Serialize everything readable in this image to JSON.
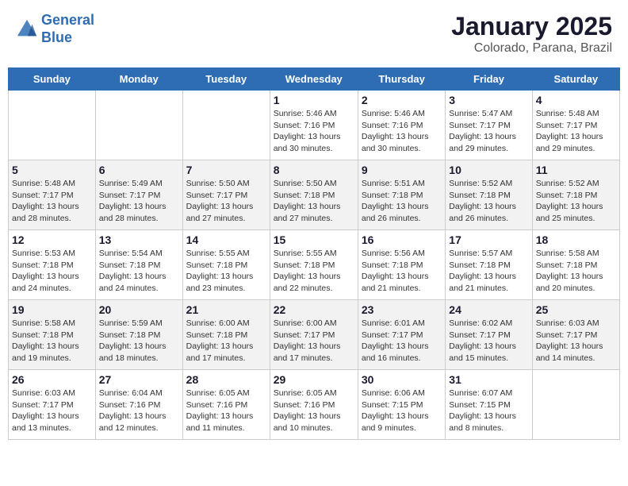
{
  "header": {
    "logo_line1": "General",
    "logo_line2": "Blue",
    "month": "January 2025",
    "location": "Colorado, Parana, Brazil"
  },
  "weekdays": [
    "Sunday",
    "Monday",
    "Tuesday",
    "Wednesday",
    "Thursday",
    "Friday",
    "Saturday"
  ],
  "weeks": [
    [
      {
        "day": "",
        "sunrise": "",
        "sunset": "",
        "daylight": ""
      },
      {
        "day": "",
        "sunrise": "",
        "sunset": "",
        "daylight": ""
      },
      {
        "day": "",
        "sunrise": "",
        "sunset": "",
        "daylight": ""
      },
      {
        "day": "1",
        "sunrise": "Sunrise: 5:46 AM",
        "sunset": "Sunset: 7:16 PM",
        "daylight": "Daylight: 13 hours and 30 minutes."
      },
      {
        "day": "2",
        "sunrise": "Sunrise: 5:46 AM",
        "sunset": "Sunset: 7:16 PM",
        "daylight": "Daylight: 13 hours and 30 minutes."
      },
      {
        "day": "3",
        "sunrise": "Sunrise: 5:47 AM",
        "sunset": "Sunset: 7:17 PM",
        "daylight": "Daylight: 13 hours and 29 minutes."
      },
      {
        "day": "4",
        "sunrise": "Sunrise: 5:48 AM",
        "sunset": "Sunset: 7:17 PM",
        "daylight": "Daylight: 13 hours and 29 minutes."
      }
    ],
    [
      {
        "day": "5",
        "sunrise": "Sunrise: 5:48 AM",
        "sunset": "Sunset: 7:17 PM",
        "daylight": "Daylight: 13 hours and 28 minutes."
      },
      {
        "day": "6",
        "sunrise": "Sunrise: 5:49 AM",
        "sunset": "Sunset: 7:17 PM",
        "daylight": "Daylight: 13 hours and 28 minutes."
      },
      {
        "day": "7",
        "sunrise": "Sunrise: 5:50 AM",
        "sunset": "Sunset: 7:17 PM",
        "daylight": "Daylight: 13 hours and 27 minutes."
      },
      {
        "day": "8",
        "sunrise": "Sunrise: 5:50 AM",
        "sunset": "Sunset: 7:18 PM",
        "daylight": "Daylight: 13 hours and 27 minutes."
      },
      {
        "day": "9",
        "sunrise": "Sunrise: 5:51 AM",
        "sunset": "Sunset: 7:18 PM",
        "daylight": "Daylight: 13 hours and 26 minutes."
      },
      {
        "day": "10",
        "sunrise": "Sunrise: 5:52 AM",
        "sunset": "Sunset: 7:18 PM",
        "daylight": "Daylight: 13 hours and 26 minutes."
      },
      {
        "day": "11",
        "sunrise": "Sunrise: 5:52 AM",
        "sunset": "Sunset: 7:18 PM",
        "daylight": "Daylight: 13 hours and 25 minutes."
      }
    ],
    [
      {
        "day": "12",
        "sunrise": "Sunrise: 5:53 AM",
        "sunset": "Sunset: 7:18 PM",
        "daylight": "Daylight: 13 hours and 24 minutes."
      },
      {
        "day": "13",
        "sunrise": "Sunrise: 5:54 AM",
        "sunset": "Sunset: 7:18 PM",
        "daylight": "Daylight: 13 hours and 24 minutes."
      },
      {
        "day": "14",
        "sunrise": "Sunrise: 5:55 AM",
        "sunset": "Sunset: 7:18 PM",
        "daylight": "Daylight: 13 hours and 23 minutes."
      },
      {
        "day": "15",
        "sunrise": "Sunrise: 5:55 AM",
        "sunset": "Sunset: 7:18 PM",
        "daylight": "Daylight: 13 hours and 22 minutes."
      },
      {
        "day": "16",
        "sunrise": "Sunrise: 5:56 AM",
        "sunset": "Sunset: 7:18 PM",
        "daylight": "Daylight: 13 hours and 21 minutes."
      },
      {
        "day": "17",
        "sunrise": "Sunrise: 5:57 AM",
        "sunset": "Sunset: 7:18 PM",
        "daylight": "Daylight: 13 hours and 21 minutes."
      },
      {
        "day": "18",
        "sunrise": "Sunrise: 5:58 AM",
        "sunset": "Sunset: 7:18 PM",
        "daylight": "Daylight: 13 hours and 20 minutes."
      }
    ],
    [
      {
        "day": "19",
        "sunrise": "Sunrise: 5:58 AM",
        "sunset": "Sunset: 7:18 PM",
        "daylight": "Daylight: 13 hours and 19 minutes."
      },
      {
        "day": "20",
        "sunrise": "Sunrise: 5:59 AM",
        "sunset": "Sunset: 7:18 PM",
        "daylight": "Daylight: 13 hours and 18 minutes."
      },
      {
        "day": "21",
        "sunrise": "Sunrise: 6:00 AM",
        "sunset": "Sunset: 7:18 PM",
        "daylight": "Daylight: 13 hours and 17 minutes."
      },
      {
        "day": "22",
        "sunrise": "Sunrise: 6:00 AM",
        "sunset": "Sunset: 7:17 PM",
        "daylight": "Daylight: 13 hours and 17 minutes."
      },
      {
        "day": "23",
        "sunrise": "Sunrise: 6:01 AM",
        "sunset": "Sunset: 7:17 PM",
        "daylight": "Daylight: 13 hours and 16 minutes."
      },
      {
        "day": "24",
        "sunrise": "Sunrise: 6:02 AM",
        "sunset": "Sunset: 7:17 PM",
        "daylight": "Daylight: 13 hours and 15 minutes."
      },
      {
        "day": "25",
        "sunrise": "Sunrise: 6:03 AM",
        "sunset": "Sunset: 7:17 PM",
        "daylight": "Daylight: 13 hours and 14 minutes."
      }
    ],
    [
      {
        "day": "26",
        "sunrise": "Sunrise: 6:03 AM",
        "sunset": "Sunset: 7:17 PM",
        "daylight": "Daylight: 13 hours and 13 minutes."
      },
      {
        "day": "27",
        "sunrise": "Sunrise: 6:04 AM",
        "sunset": "Sunset: 7:16 PM",
        "daylight": "Daylight: 13 hours and 12 minutes."
      },
      {
        "day": "28",
        "sunrise": "Sunrise: 6:05 AM",
        "sunset": "Sunset: 7:16 PM",
        "daylight": "Daylight: 13 hours and 11 minutes."
      },
      {
        "day": "29",
        "sunrise": "Sunrise: 6:05 AM",
        "sunset": "Sunset: 7:16 PM",
        "daylight": "Daylight: 13 hours and 10 minutes."
      },
      {
        "day": "30",
        "sunrise": "Sunrise: 6:06 AM",
        "sunset": "Sunset: 7:15 PM",
        "daylight": "Daylight: 13 hours and 9 minutes."
      },
      {
        "day": "31",
        "sunrise": "Sunrise: 6:07 AM",
        "sunset": "Sunset: 7:15 PM",
        "daylight": "Daylight: 13 hours and 8 minutes."
      },
      {
        "day": "",
        "sunrise": "",
        "sunset": "",
        "daylight": ""
      }
    ]
  ]
}
